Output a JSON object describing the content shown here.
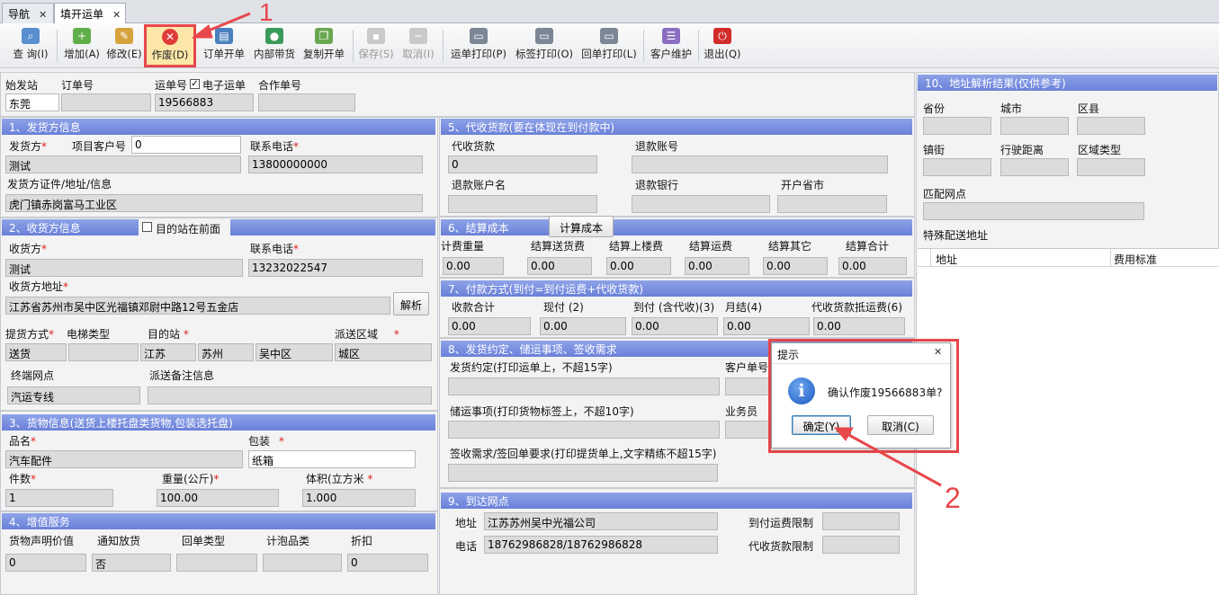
{
  "tabs": [
    {
      "label": "导航",
      "close": "✕"
    },
    {
      "label": "填开运单",
      "close": "✕"
    }
  ],
  "toolbar": {
    "query": "查 询(I)",
    "add": "增加(A)",
    "edit": "修改(E)",
    "void": "作废(D)",
    "order_open": "订单开单",
    "internal": "内部带货",
    "copy": "复制开单",
    "save": "保存(S)",
    "cancel": "取消(I)",
    "print_waybill": "运单打印(P)",
    "print_label": "标签打印(O)",
    "print_receipt": "回单打印(L)",
    "customer": "客户维护",
    "exit": "退出(Q)"
  },
  "annotations": {
    "one": "1",
    "two": "2"
  },
  "top": {
    "start_label": "始发站",
    "start_value": "东莞",
    "order_label": "订单号",
    "order_value": "",
    "waybill_label": "运单号",
    "electronic_label": "电子运单",
    "waybill_value": "19566883",
    "coop_label": "合作单号",
    "coop_value": ""
  },
  "shipper": {
    "header": "1、发货方信息",
    "sender_label": "发货方",
    "item_cust_label": "项目客户号",
    "item_cust_value": "0",
    "phone_label": "联系电话",
    "sender_value": "测试",
    "phone_value": "13800000000",
    "cert_label": "发货方证件/地址/信息",
    "cert_value": "虎门镇赤岗富马工业区"
  },
  "receiver": {
    "header": "2、收货方信息",
    "dest_front_label": "目的站在前面",
    "name_label": "收货方",
    "phone_label": "联系电话",
    "name_value": "测试",
    "phone_value": "13232022547",
    "addr_label": "收货方地址",
    "addr_value": "江苏省苏州市吴中区光福镇邓尉中路12号五金店",
    "parse_btn": "解析",
    "pickup_label": "提货方式",
    "elevator_label": "电梯类型",
    "dest_label": "目的站",
    "area_label": "派送区域",
    "pickup_value": "送货",
    "elevator_value": "",
    "province": "江苏",
    "city": "苏州",
    "district": "吴中区",
    "area_value": "城区",
    "terminal_label": "终端网点",
    "remark_label": "派送备注信息",
    "terminal_value": "汽运专线",
    "remark_value": ""
  },
  "goods": {
    "header": "3、货物信息(送货上楼托盘类货物,包装选托盘)",
    "name_label": "品名",
    "pack_label": "包装",
    "name_value": "汽车配件",
    "pack_value": "纸箱",
    "count_label": "件数",
    "weight_label": "重量(公斤)",
    "volume_label": "体积(立方米",
    "count_value": "1",
    "weight_value": "100.00",
    "volume_value": "1.000"
  },
  "addservice": {
    "header": "4、增值服务",
    "labels": [
      "货物声明价值",
      "通知放货",
      "回单类型",
      "计泡品类",
      "折扣"
    ],
    "values": [
      "0",
      "否",
      "",
      "",
      "0"
    ]
  },
  "cod": {
    "header": "5、代收货款(要在体现在到付款中)",
    "cod_label": "代收货款",
    "refund_acct_label": "退款账号",
    "cod_value": "0",
    "refund_acct_value": "",
    "holder_label": "退款账户名",
    "bank_label": "退款银行",
    "province_label": "开户省市"
  },
  "settle": {
    "header": "6、结算成本",
    "calc_btn": "计算成本",
    "labels": [
      "计费重量",
      "结算送货费",
      "结算上楼费",
      "结算运费",
      "结算其它",
      "结算合计"
    ],
    "values": [
      "0.00",
      "0.00",
      "0.00",
      "0.00",
      "0.00",
      "0.00"
    ]
  },
  "payment": {
    "header": "7、付款方式(到付=到付运费+代收货款)",
    "labels": [
      "收款合计",
      "现付 (2)",
      "到付 (含代收)(3)",
      "月结(4)",
      "代收货款抵运费(6)"
    ],
    "values": [
      "0.00",
      "0.00",
      "0.00",
      "0.00",
      "0.00"
    ]
  },
  "agreement": {
    "header": "8、发货约定、储运事项、签收需求",
    "ship_label": "发货约定(打印运单上，不超15字)",
    "cust_no_label": "客户单号",
    "storage_label": "储运事项(打印货物标签上，不超10字)",
    "sales_label": "业务员",
    "sign_label": "签收需求/签回单要求(打印提货单上,文字精练不超15字)"
  },
  "arrival": {
    "header": "9、到达网点",
    "addr_label": "地址",
    "addr_value": "江苏苏州吴中光福公司",
    "phone_label": "电话",
    "phone_value": "18762986828/18762986828",
    "freight_limit_label": "到付运费限制",
    "cod_limit_label": "代收货款限制"
  },
  "parse": {
    "header": "10、地址解析结果(仅供参考)",
    "province": "省份",
    "city": "城市",
    "district": "区县",
    "town": "镇街",
    "distance": "行驶距离",
    "area_type": "区域类型",
    "match": "匹配网点",
    "special": "特殊配送地址",
    "col_addr": "地址",
    "col_fee": "费用标准"
  },
  "dialog": {
    "title": "提示",
    "close": "✕",
    "message": "确认作废19566883单?",
    "ok": "确定(Y)",
    "cancel": "取消(C)"
  },
  "colors": {
    "accent": "#6a80d8",
    "highlight": "#e8474b"
  }
}
